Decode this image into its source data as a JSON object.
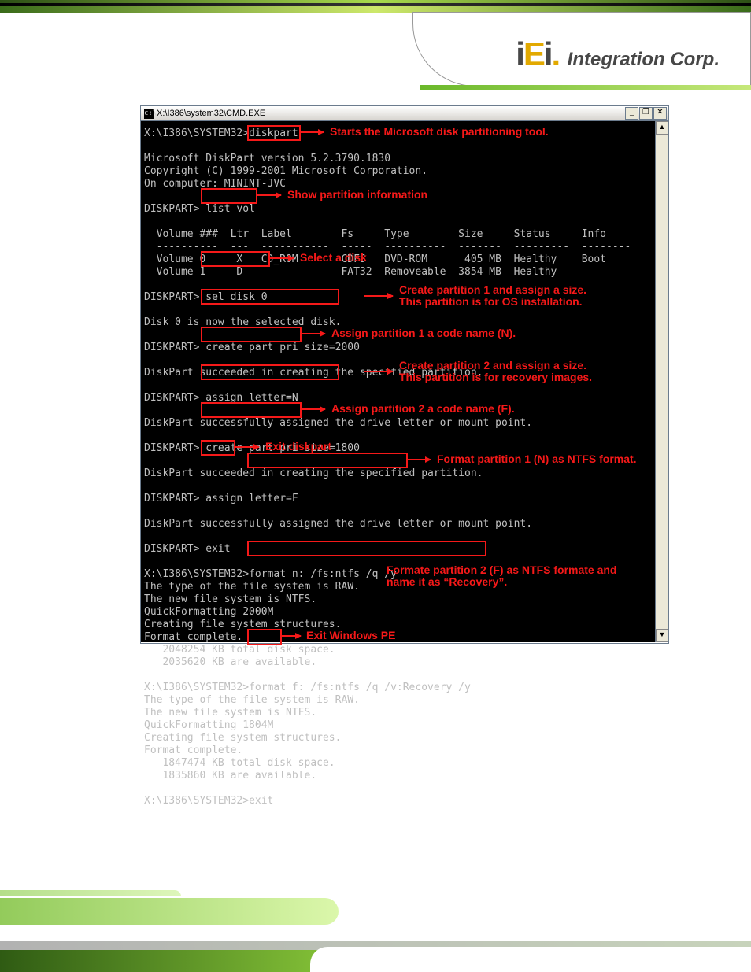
{
  "brand": {
    "company": "Integration Corp.",
    "logo_text": "iEi"
  },
  "window": {
    "title": "X:\\I386\\system32\\CMD.EXE",
    "icon_glyph": "c:\\"
  },
  "console": {
    "prompt_sys": "X:\\I386\\SYSTEM32>",
    "prompt_dp": "DISKPART>",
    "cmd_diskpart": "diskpart",
    "cmd_listvol": "list vol",
    "cmd_seldisk": "sel disk 0",
    "cmd_create1": "create part pri size=",
    "cmd_create1_sz": "2000",
    "cmd_assignN": "assign letter=N",
    "cmd_create2": "create part pri size=",
    "cmd_create2_sz": "1800",
    "cmd_assignF": "assign letter=F",
    "cmd_exit": "exit",
    "cmd_fmtN": "format n: /fs:ntfs /q /y",
    "cmd_fmtF": "format f: /fs:ntfs /q /v:Recovery /y",
    "lines": {
      "ver": "Microsoft DiskPart version 5.2.3790.1830",
      "copy": "Copyright (C) 1999-2001 Microsoft Corporation.",
      "comp": "On computer: MININT-JVC",
      "vol_hdr": "  Volume ###  Ltr  Label        Fs     Type        Size     Status     Info",
      "vol_sep": "  ----------  ---  -----------  -----  ----------  -------  ---------  --------",
      "vol0": "  Volume 0     X   CD_ROM       CDFS   DVD-ROM      405 MB  Healthy    Boot",
      "vol1": "  Volume 1     D                FAT32  Removeable  3854 MB  Healthy",
      "selok": "Disk 0 is now the selected disk.",
      "created": "DiskPart succeeded in creating the specified partition.",
      "assigned": "DiskPart successfully assigned the drive letter or mount point.",
      "raw": "The type of the file system is RAW.",
      "ntfs": "The new file system is NTFS.",
      "qf2000": "QuickFormatting 2000M",
      "qf1804": "QuickFormatting 1804M",
      "creating": "Creating file system structures.",
      "fdone": "Format complete.",
      "sp1a": "   2048254 KB total disk space.",
      "sp1b": "   2035620 KB are available.",
      "sp2a": "   1847474 KB total disk space.",
      "sp2b": "   1835860 KB are available."
    }
  },
  "annotations": {
    "a1": "Starts the Microsoft disk partitioning tool.",
    "a2": "Show partition information",
    "a3": "Select a disk",
    "a4a": "Create partition 1 and assign a size.",
    "a4b": "This partition is for OS installation.",
    "a5": "Assign partition 1 a code name (N).",
    "a6a": "Create partition 2 and assign a size.",
    "a6b": "This partition is for recovery images.",
    "a7": "Assign partition 2 a code name (F).",
    "a8": "Exit diskpart",
    "a9": "Format partition 1 (N) as NTFS format.",
    "a10a": "Formate partition 2 (F) as NTFS formate and",
    "a10b": "name it as “Recovery”.",
    "a11": "Exit Windows PE"
  }
}
